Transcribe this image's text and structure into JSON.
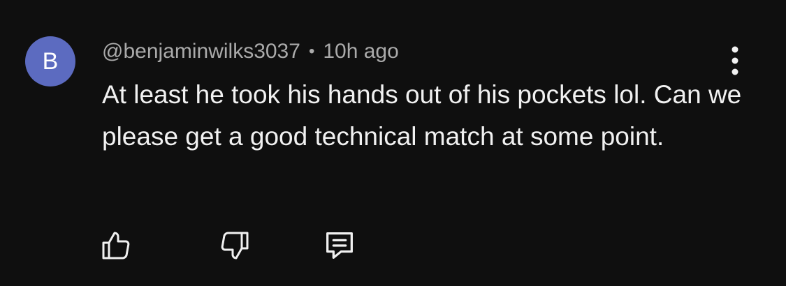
{
  "comment": {
    "avatar_letter": "B",
    "avatar_color": "#5c6bc0",
    "author": "@benjaminwilks3037",
    "separator": "•",
    "time": "10h ago",
    "text": "At least he took his hands out of his pockets lol. Can we please get a good technical match at some point."
  },
  "icons": {
    "more": "more-vertical-icon",
    "like": "thumbs-up-icon",
    "dislike": "thumbs-down-icon",
    "reply": "reply-comment-icon"
  },
  "colors": {
    "background": "#0f0f0f",
    "text": "#f1f1f1",
    "meta": "#aaaaaa"
  }
}
